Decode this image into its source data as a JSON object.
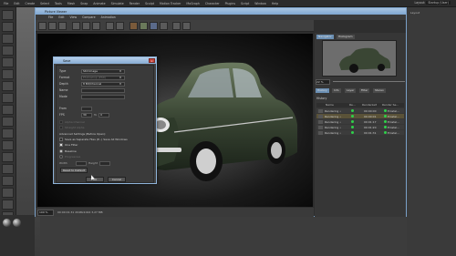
{
  "app_menu": {
    "items": [
      "File",
      "Edit",
      "Create",
      "Select",
      "Tools",
      "Mesh",
      "Snap",
      "Animate",
      "Simulate",
      "Render",
      "Sculpt",
      "Motion Tracker",
      "MoGraph",
      "Character",
      "Plugins",
      "Script",
      "Window",
      "Help"
    ],
    "layout_label": "Layout:",
    "layout_value": "Startup (User)"
  },
  "picture_viewer": {
    "title": "Picture Viewer",
    "menu": [
      "File",
      "Edit",
      "View",
      "Compare",
      "Animation"
    ],
    "status": {
      "zoom": "100 %",
      "info": "00:00:01:31  2048x1024  3,27 MB"
    },
    "side": {
      "tabs": [
        "Navigator",
        "Histogram"
      ],
      "zoom_value": "22 %",
      "subtabs": [
        "History",
        "Info",
        "Layer",
        "Filter",
        "Stereo"
      ],
      "history_label": "History",
      "history_columns": [
        "Name",
        "Re...",
        "Renderzeit",
        "Render Se..."
      ],
      "history_rows": [
        {
          "name": "Rendering •",
          "time": "00:00:00",
          "setting": "Einstel..."
        },
        {
          "name": "Rendering •",
          "time": "00:00:01",
          "setting": "Einstel..."
        },
        {
          "name": "Rendering •",
          "time": "00:01:17",
          "setting": "Einstel..."
        },
        {
          "name": "Rendering •",
          "time": "00:01:20",
          "setting": "Einstel..."
        },
        {
          "name": "Rendering •",
          "time": "00:01:31",
          "setting": "Einstel..."
        }
      ]
    }
  },
  "save_dialog": {
    "title": "Save",
    "close": "x",
    "fields": [
      {
        "label": "Type",
        "value": "Still Image"
      },
      {
        "label": "Format",
        "value": "Photoshop (PSD)"
      },
      {
        "label": "Depth",
        "value": "8 Bit/Channel"
      },
      {
        "label": "Name",
        "value": ""
      },
      {
        "label": "Mode",
        "value": ""
      }
    ],
    "frame_label": "From",
    "fps_label": "FPS",
    "fps_value": "30",
    "to_label": "To",
    "to_value": "0",
    "opt_alpha": "Alpha Channel",
    "opt_straight": "Straight Alpha",
    "advanced_label": "Advanced Settings (Before Open):",
    "opt_separate": "Save as Separate Files (P...) Save All Windows",
    "opt_one_filter": "One Filter",
    "opt_baseline": "Baseline",
    "opt_progressive": "Progressive",
    "width_label": "Width",
    "height_label": "Height",
    "reset_label": "Reset to Default",
    "ok": "OK",
    "cancel": "Cancel"
  },
  "right_panel": {
    "tabs": [
      "Layout"
    ],
    "caption": "Start"
  },
  "colors": {
    "title_blue": "#86acd3",
    "status_green": "#2fd14a",
    "selected_row": "#5a5238"
  }
}
